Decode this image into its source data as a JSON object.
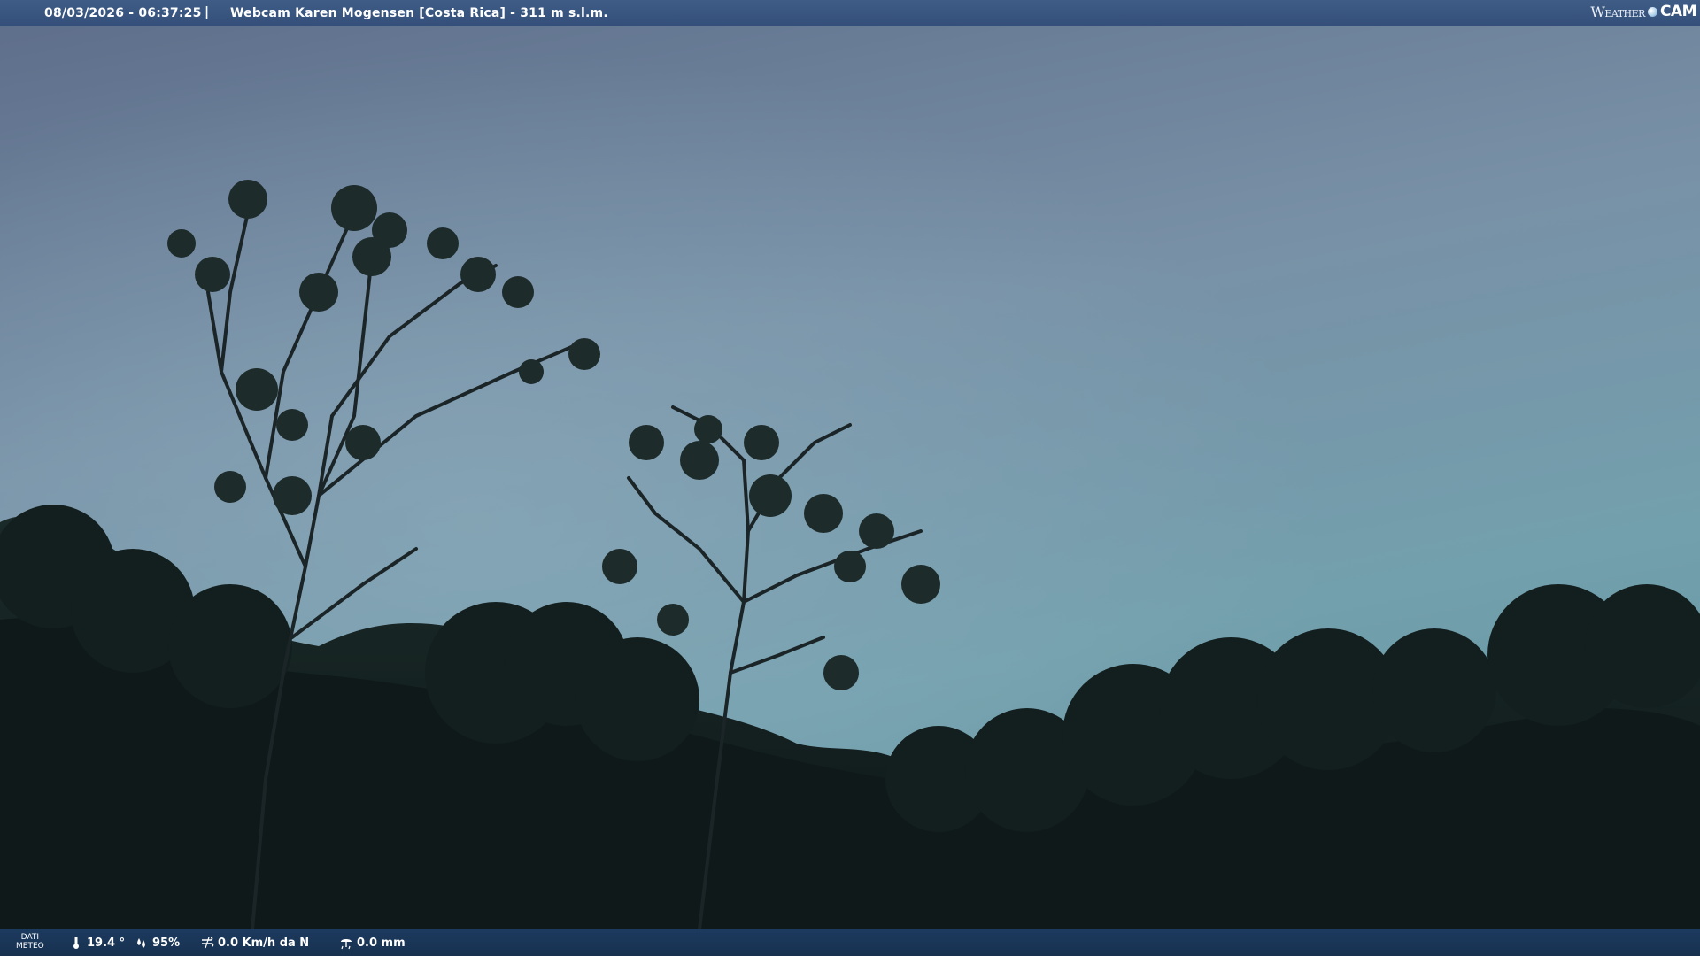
{
  "header": {
    "datetime": "08/03/2026 - 06:37:25",
    "separator": "|",
    "camera_name": "Webcam Karen Mogensen [Costa Rica]  - 311 m s.l.m.",
    "logo_word_weather": "Weather",
    "logo_word_cam": "CAM"
  },
  "footer": {
    "dati_label_line1": "DATI",
    "dati_label_line2": "METEO",
    "temperature": "19.4 °",
    "humidity": "95%",
    "wind": "0.0 Km/h da N",
    "rain": "0.0 mm",
    "icons": {
      "temperature": "thermometer-icon",
      "humidity": "humidity-drops-icon",
      "wind": "wind-icon",
      "rain": "rain-gauge-icon"
    }
  },
  "colors": {
    "header_bg": "#3a577f",
    "footer_bg": "#1a3556",
    "sky_top": "#5b6f8c",
    "sky_bottom": "#76a2ae",
    "forest": "#101a1b"
  }
}
